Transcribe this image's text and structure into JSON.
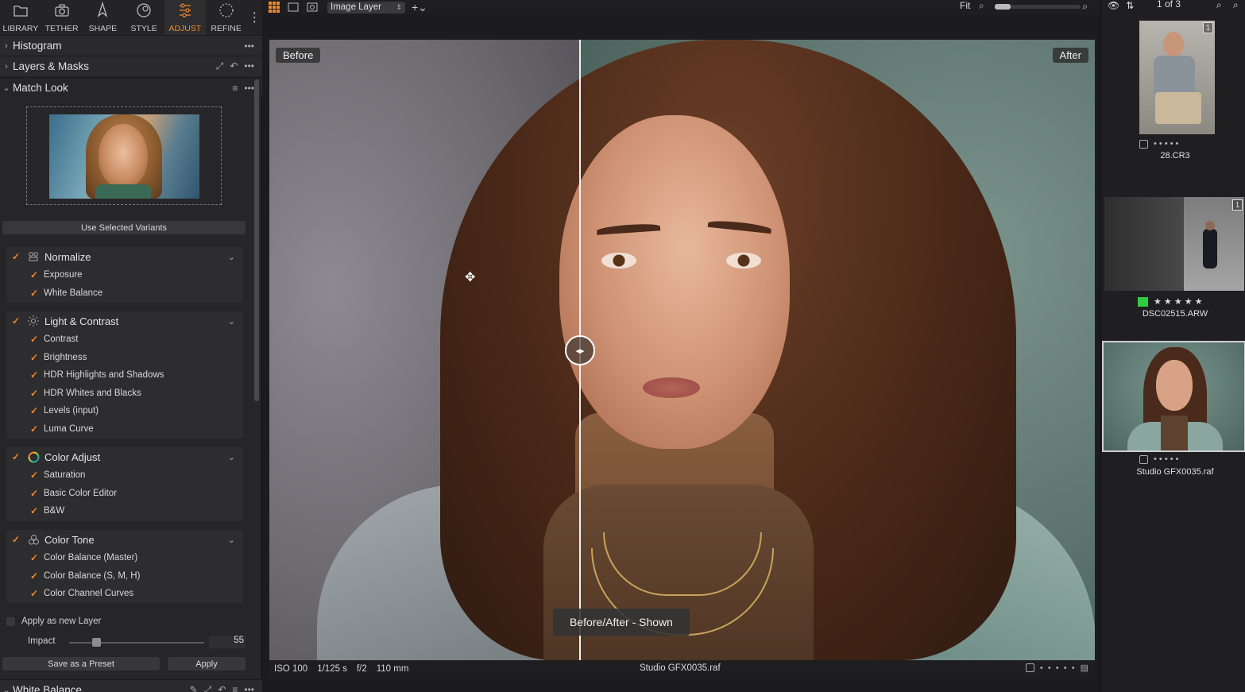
{
  "tabs": [
    {
      "label": "LIBRARY",
      "icon": "folder-icon"
    },
    {
      "label": "TETHER",
      "icon": "camera-icon"
    },
    {
      "label": "SHAPE",
      "icon": "shape-icon"
    },
    {
      "label": "STYLE",
      "icon": "style-icon"
    },
    {
      "label": "ADJUST",
      "icon": "adjust-sliders-icon",
      "active": true
    },
    {
      "label": "REFINE",
      "icon": "refine-icon"
    }
  ],
  "sections": {
    "histogram": "Histogram",
    "layers": "Layers & Masks",
    "match_look": "Match Look",
    "white_balance": "White Balance"
  },
  "match_look": {
    "use_selected": "Use Selected Variants",
    "groups": [
      {
        "title": "Normalize",
        "icon": "normalize-icon",
        "items": [
          "Exposure",
          "White Balance"
        ]
      },
      {
        "title": "Light & Contrast",
        "icon": "light-contrast-icon",
        "items": [
          "Contrast",
          "Brightness",
          "HDR Highlights and Shadows",
          "HDR Whites and Blacks",
          "Levels (input)",
          "Luma Curve"
        ]
      },
      {
        "title": "Color Adjust",
        "icon": "color-wheel-icon",
        "items": [
          "Saturation",
          "Basic Color Editor",
          "B&W"
        ]
      },
      {
        "title": "Color Tone",
        "icon": "color-tone-icon",
        "items": [
          "Color Balance (Master)",
          "Color Balance (S, M, H)",
          "Color Channel Curves"
        ]
      }
    ],
    "apply_as_layer": "Apply as new Layer",
    "impact_label": "Impact",
    "impact_value": "55",
    "impact_fraction": 0.2,
    "save_preset": "Save as a Preset",
    "apply": "Apply"
  },
  "toolbar": {
    "layer": "Image Layer",
    "fit": "Fit"
  },
  "viewer": {
    "before": "Before",
    "after": "After",
    "toast": "Before/After - Shown"
  },
  "info": {
    "iso": "ISO 100",
    "shutter": "1/125 s",
    "aperture": "f/2",
    "focal": "110 mm",
    "filename": "Studio GFX0035.raf"
  },
  "browser": {
    "count": "1 of 3",
    "items": [
      {
        "name": "28.CR3",
        "badge": "1",
        "rating": 0
      },
      {
        "name": "DSC02515.ARW",
        "badge": "1",
        "rating": 5,
        "color_tag": "#2ecc40"
      },
      {
        "name": "Studio GFX0035.raf",
        "rating": 0,
        "selected": true
      }
    ]
  },
  "colors": {
    "accent": "#f08a2a"
  }
}
